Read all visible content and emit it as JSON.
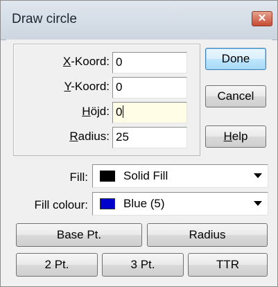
{
  "window": {
    "title": "Draw circle"
  },
  "fields": [
    {
      "prefix": "X",
      "suffix": "-Koord:",
      "value": "0"
    },
    {
      "prefix": "Y",
      "suffix": "-Koord:",
      "value": "0"
    },
    {
      "prefix": "H",
      "suffix": "öjd:",
      "value": "0"
    },
    {
      "prefix": "R",
      "suffix": "adius:",
      "value": "25"
    }
  ],
  "buttons": {
    "done": "Done",
    "cancel": "Cancel",
    "help_prefix": "H",
    "help_suffix": "elp",
    "base_pt": "Base Pt.",
    "radius": "Radius",
    "two_pt": "2 Pt.",
    "three_pt": "3 Pt.",
    "ttr": "TTR"
  },
  "fill": {
    "label": "Fill:",
    "value": "Solid Fill",
    "swatch_color": "#000000"
  },
  "fill_colour": {
    "label": "Fill colour:",
    "value": "Blue (5)",
    "swatch_color": "#0000cc"
  },
  "colors": {
    "close_button": "#c64b33",
    "default_button_border": "#3c7fb1"
  }
}
